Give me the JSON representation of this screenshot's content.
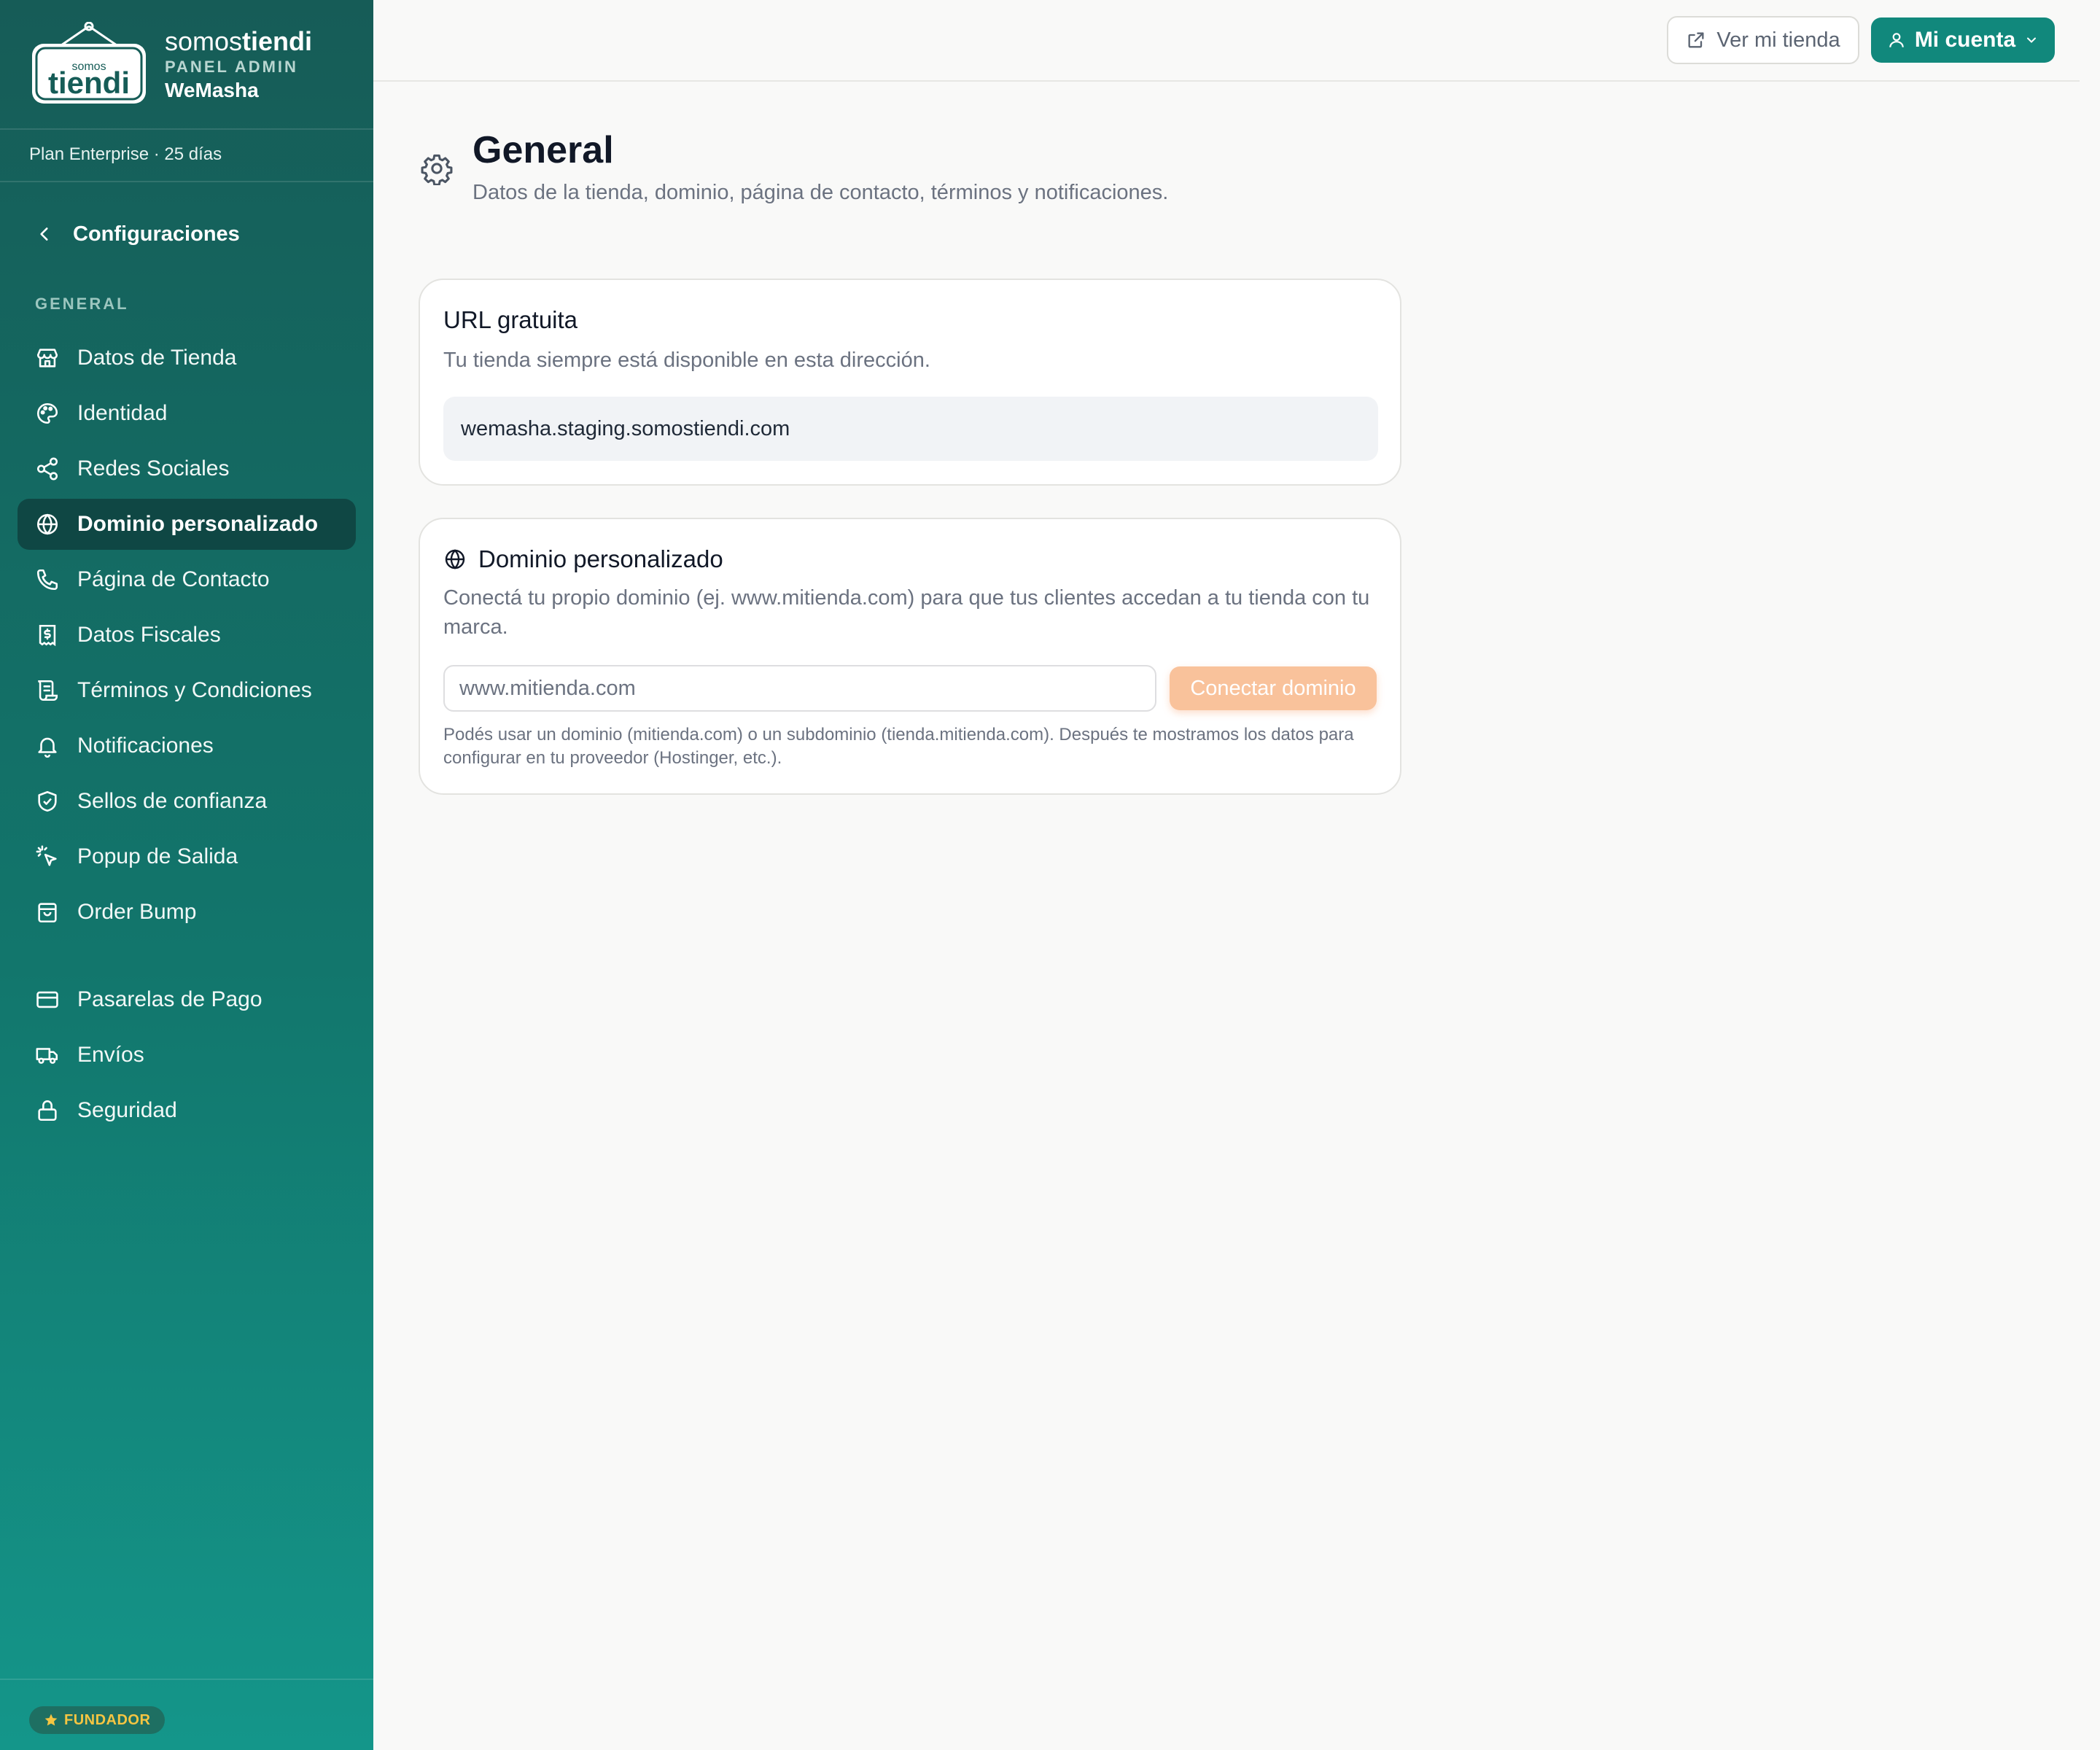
{
  "brand": {
    "name_light": "somos",
    "name_bold": "tiendi",
    "subtitle": "PANEL ADMIN",
    "store": "WeMasha",
    "logo_small": "somos",
    "logo_big": "tiendi"
  },
  "plan": "Plan Enterprise · 25 días",
  "back_label": "Configuraciones",
  "sections": {
    "general": "GENERAL"
  },
  "nav_general": [
    {
      "label": "Datos de Tienda",
      "icon": "store-icon"
    },
    {
      "label": "Identidad",
      "icon": "palette-icon"
    },
    {
      "label": "Redes Sociales",
      "icon": "share-icon"
    },
    {
      "label": "Dominio personalizado",
      "icon": "globe-icon",
      "active": true
    },
    {
      "label": "Página de Contacto",
      "icon": "phone-icon"
    },
    {
      "label": "Datos Fiscales",
      "icon": "receipt-icon"
    },
    {
      "label": "Términos y Condiciones",
      "icon": "scroll-icon"
    },
    {
      "label": "Notificaciones",
      "icon": "bell-icon"
    },
    {
      "label": "Sellos de confianza",
      "icon": "shield-icon"
    },
    {
      "label": "Popup de Salida",
      "icon": "pointer-click-icon"
    },
    {
      "label": "Order Bump",
      "icon": "bag-icon"
    }
  ],
  "nav_other": [
    {
      "label": "Pasarelas de Pago",
      "icon": "credit-card-icon"
    },
    {
      "label": "Envíos",
      "icon": "truck-icon"
    },
    {
      "label": "Seguridad",
      "icon": "lock-icon"
    }
  ],
  "footer_badge": "FUNDADOR",
  "topbar": {
    "view_store": "Ver mi tienda",
    "account": "Mi cuenta"
  },
  "page": {
    "title": "General",
    "subtitle": "Datos de la tienda, dominio, página de contacto, términos y notificaciones."
  },
  "free_url": {
    "title": "URL gratuita",
    "description": "Tu tienda siempre está disponible en esta dirección.",
    "value": "wemasha.staging.somostiendi.com"
  },
  "custom_domain": {
    "title": "Dominio personalizado",
    "description": "Conectá tu propio dominio (ej. www.mitienda.com) para que tus clientes accedan a tu tienda con tu marca.",
    "input_placeholder": "www.mitienda.com",
    "input_value": "",
    "button": "Conectar dominio",
    "hint": "Podés usar un dominio (mitienda.com) o un subdominio (tienda.mitienda.com). Después te mostramos los datos para configurar en tu proveedor (Hostinger, etc.)."
  },
  "colors": {
    "sidebar_top": "#165c57",
    "sidebar_bottom": "#14968a",
    "accent": "#11887c",
    "connect_button": "#f9c29b",
    "badge_star": "#f5c542"
  }
}
